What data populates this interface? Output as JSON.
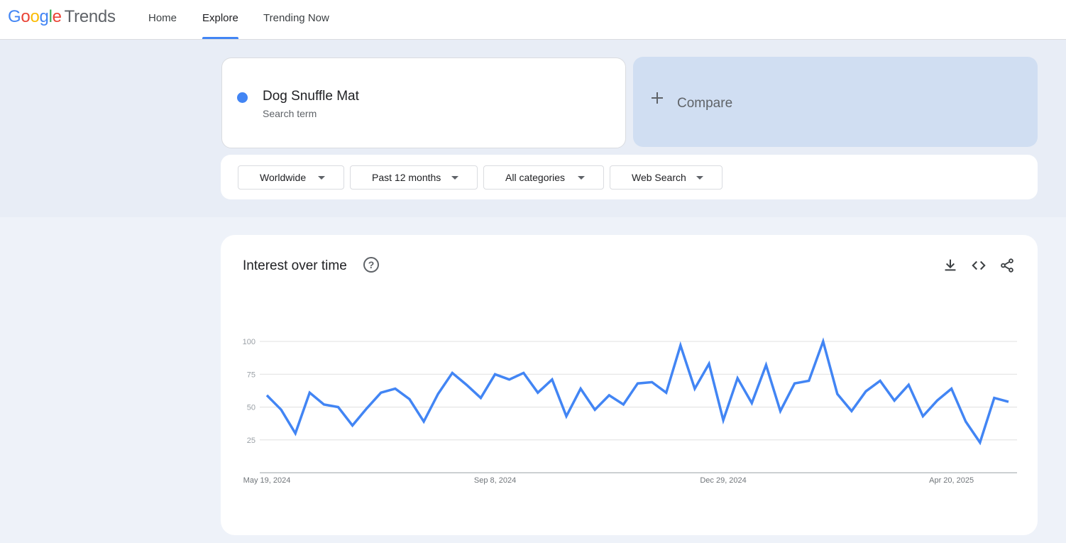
{
  "app": {
    "logo_letters": [
      "G",
      "o",
      "o",
      "g",
      "l",
      "e"
    ],
    "logo_product": "Trends"
  },
  "nav": {
    "items": [
      {
        "label": "Home",
        "active": false
      },
      {
        "label": "Explore",
        "active": true
      },
      {
        "label": "Trending Now",
        "active": false
      }
    ]
  },
  "search": {
    "term": "Dog Snuffle Mat",
    "term_type": "Search term",
    "term_color": "#4285f4",
    "compare_label": "Compare"
  },
  "filters": {
    "region": "Worldwide",
    "time_range": "Past 12 months",
    "category": "All categories",
    "search_type": "Web Search"
  },
  "panel": {
    "title": "Interest over time",
    "icons": [
      "help-icon",
      "download-icon",
      "embed-icon",
      "share-icon"
    ]
  },
  "chart_data": {
    "type": "line",
    "x_labels": [
      "May 19, 2024",
      "Sep 8, 2024",
      "Dec 29, 2024",
      "Apr 20, 2025"
    ],
    "ylim": [
      0,
      100
    ],
    "y_ticks": [
      25,
      50,
      75,
      100
    ],
    "series": [
      {
        "color": "#4285f4",
        "values": [
          59,
          48,
          30,
          61,
          52,
          50,
          36,
          49,
          61,
          64,
          56,
          39,
          60,
          76,
          67,
          57,
          75,
          71,
          76,
          61,
          71,
          43,
          64,
          48,
          59,
          52,
          68,
          69,
          61,
          97,
          64,
          83,
          40,
          72,
          53,
          82,
          47,
          68,
          70,
          100,
          60,
          47,
          62,
          70,
          55,
          67,
          43,
          55,
          64,
          39,
          23,
          57,
          54
        ]
      }
    ],
    "grid": true,
    "legend": false
  }
}
